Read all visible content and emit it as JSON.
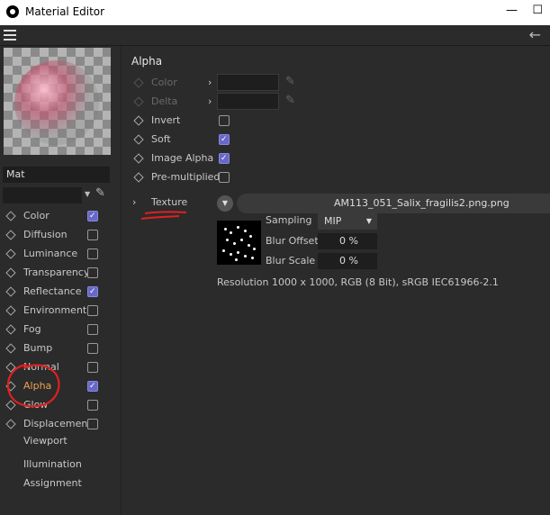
{
  "window": {
    "title": "Material Editor",
    "minimize": "—",
    "maximize": "☐"
  },
  "material": {
    "name": "Mat"
  },
  "channels": [
    {
      "label": "Color",
      "checked": true
    },
    {
      "label": "Diffusion",
      "checked": false
    },
    {
      "label": "Luminance",
      "checked": false
    },
    {
      "label": "Transparency",
      "checked": false
    },
    {
      "label": "Reflectance",
      "checked": true
    },
    {
      "label": "Environment",
      "checked": false
    },
    {
      "label": "Fog",
      "checked": false
    },
    {
      "label": "Bump",
      "checked": false
    },
    {
      "label": "Normal",
      "checked": false
    },
    {
      "label": "Alpha",
      "checked": true,
      "active": true
    },
    {
      "label": "Glow",
      "checked": false
    },
    {
      "label": "Displacement",
      "checked": false
    }
  ],
  "extra_items": [
    "Viewport",
    "Illumination",
    "Assignment"
  ],
  "section": {
    "title": "Alpha"
  },
  "params": [
    {
      "label": "Color",
      "type": "color",
      "dim": true
    },
    {
      "label": "Delta",
      "type": "color",
      "dim": true
    },
    {
      "label": "Invert",
      "type": "checkbox",
      "checked": false
    },
    {
      "label": "Soft",
      "type": "checkbox",
      "checked": true
    },
    {
      "label": "Image Alpha",
      "type": "checkbox",
      "checked": true
    },
    {
      "label": "Pre-multiplied",
      "type": "checkbox",
      "checked": false
    }
  ],
  "texture": {
    "label": "Texture",
    "filename": "AM113_051_Salix_fragilis2.png.png",
    "sampling_label": "Sampling",
    "sampling_value": "MIP",
    "blur_offset_label": "Blur Offset",
    "blur_offset_value": "0 %",
    "blur_scale_label": "Blur Scale",
    "blur_scale_value": "0 %",
    "resolution": "Resolution 1000 x 1000, RGB (8 Bit), sRGB IEC61966-2.1"
  },
  "colors": {
    "accent_active": "#f0a050",
    "checkbox_on": "#6868c8",
    "annotation": "#e02020"
  }
}
